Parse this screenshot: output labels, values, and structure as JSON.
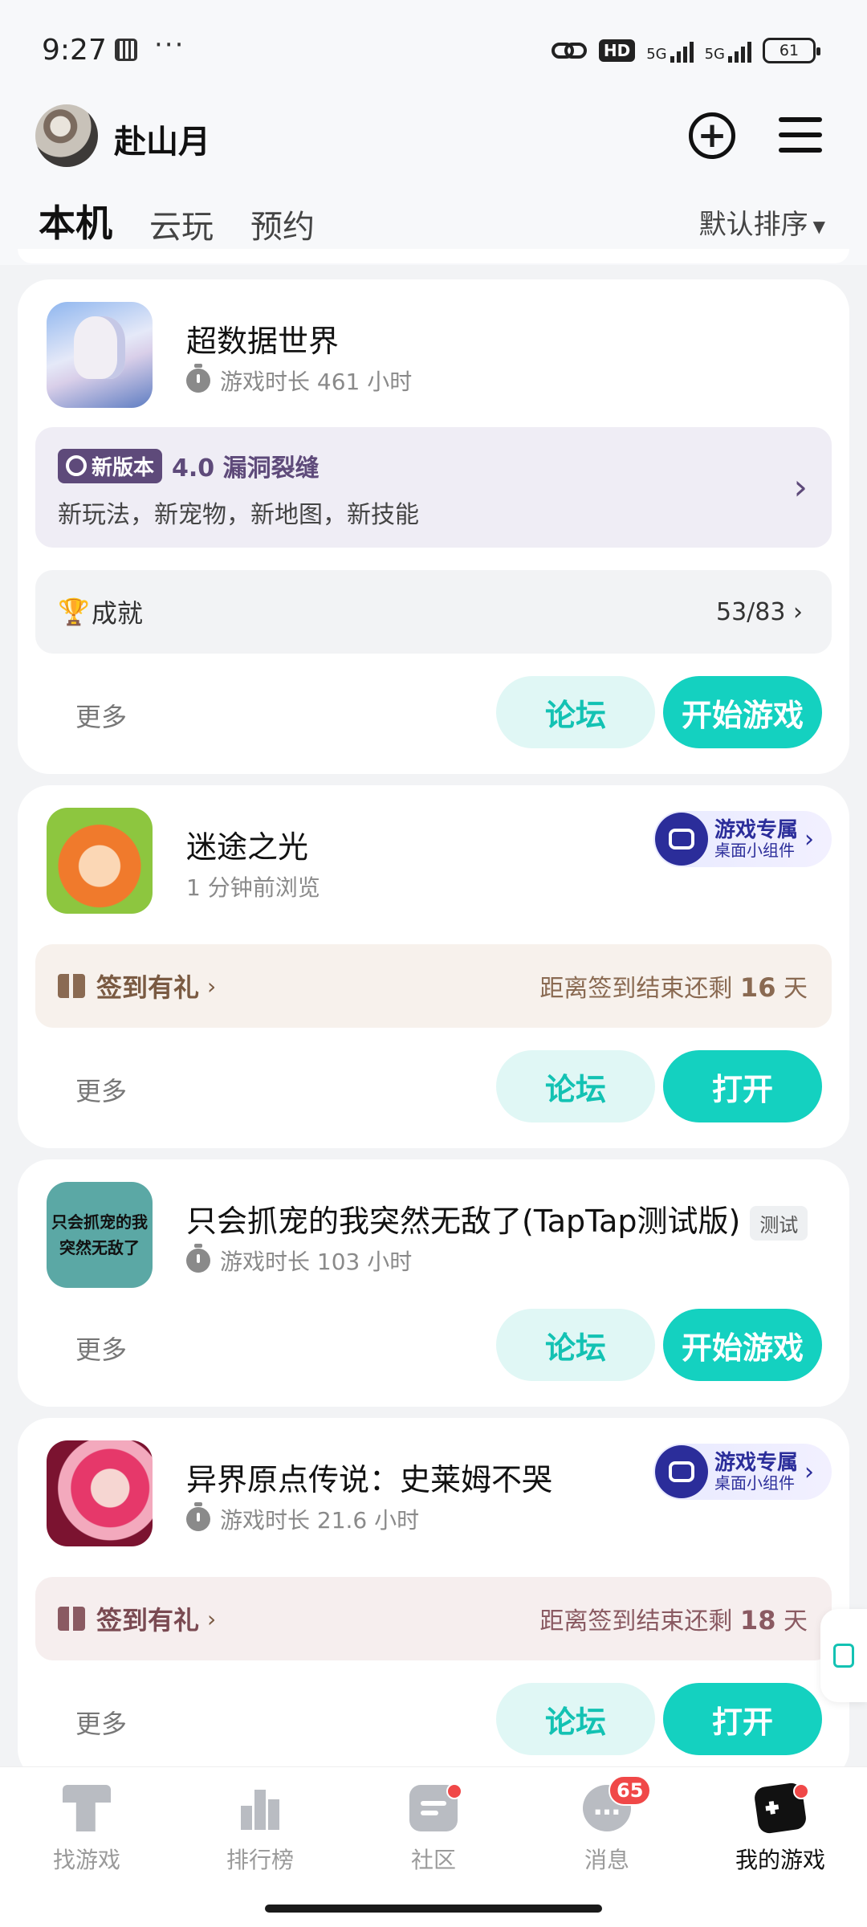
{
  "status_bar": {
    "time": "9:27",
    "dots": "···",
    "hd": "HD",
    "net1": "5G",
    "net2": "5G",
    "battery": "61"
  },
  "header": {
    "username": "赴山月",
    "tabs": [
      "本机",
      "云玩",
      "预约"
    ],
    "sort_label": "默认排序"
  },
  "games": [
    {
      "title": "超数据世界",
      "subtitle": "游戏时长 461 小时",
      "version_badge": "新版本",
      "version_name": "4.0 漏洞裂缝",
      "version_desc": "新玩法，新宠物，新地图，新技能",
      "achievement_label": "成就",
      "achievement_count": "53/83",
      "more": "更多",
      "forum": "论坛",
      "action": "开始游戏"
    },
    {
      "title": "迷途之光",
      "subtitle": "1 分钟前浏览",
      "widget_title": "游戏专属",
      "widget_sub": "桌面小组件",
      "signin_label": "签到有礼",
      "signin_prefix": "距离签到结束还剩",
      "signin_days": "16",
      "signin_unit": "天",
      "more": "更多",
      "forum": "论坛",
      "action": "打开"
    },
    {
      "title": "只会抓宠的我突然无敌了(TapTap测试版)",
      "tag": "测试",
      "subtitle": "游戏时长 103 小时",
      "icon_text1": "只会抓宠的我",
      "icon_text2": "突然无敌了",
      "more": "更多",
      "forum": "论坛",
      "action": "开始游戏"
    },
    {
      "title": "异界原点传说：史莱姆不哭",
      "subtitle": "游戏时长 21.6 小时",
      "widget_title": "游戏专属",
      "widget_sub": "桌面小组件",
      "signin_label": "签到有礼",
      "signin_prefix": "距离签到结束还剩",
      "signin_days": "18",
      "signin_unit": "天",
      "more": "更多",
      "forum": "论坛",
      "action": "打开"
    }
  ],
  "bottom_nav": {
    "items": [
      {
        "label": "找游戏",
        "icon": "find-game-icon"
      },
      {
        "label": "排行榜",
        "icon": "ranking-icon"
      },
      {
        "label": "社区",
        "icon": "community-icon"
      },
      {
        "label": "消息",
        "icon": "message-icon",
        "badge": "65"
      },
      {
        "label": "我的游戏",
        "icon": "my-games-icon"
      }
    ]
  },
  "colors": {
    "accent": "#14d1c0",
    "accent_light": "#e0f7f5",
    "version_purple": "#5e4a7a",
    "signin_brown": "#8a6a52",
    "badge_red": "#f04848"
  }
}
